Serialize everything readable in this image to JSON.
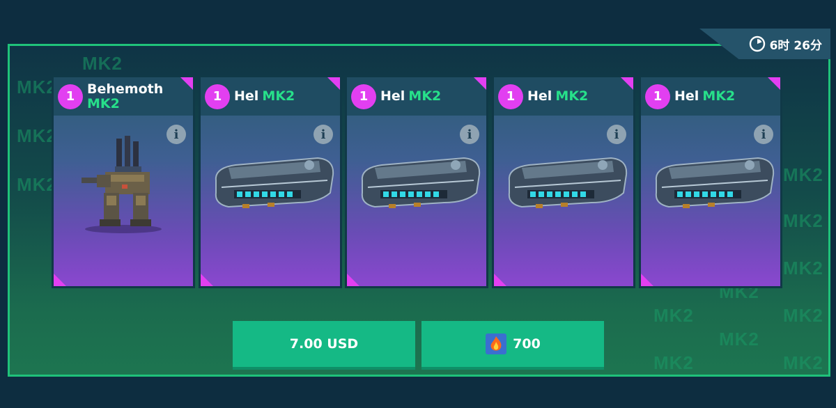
{
  "timer": {
    "icon": "clock-icon",
    "text": "6时 26分"
  },
  "watermarks": [
    "MK2",
    "MK2",
    "MK2",
    "MK2",
    "MK2",
    "MK2",
    "MK2",
    "MK2",
    "MK2",
    "MK2",
    "MK2",
    "MK2",
    "MK2",
    "MK2",
    "MK2",
    "MK2"
  ],
  "cards": [
    {
      "quantity": "1",
      "name": "Behemoth",
      "tier": "MK2",
      "type": "robot",
      "info_icon": "info-icon"
    },
    {
      "quantity": "1",
      "name": "Hel",
      "tier": "MK2",
      "type": "weapon",
      "info_icon": "info-icon"
    },
    {
      "quantity": "1",
      "name": "Hel",
      "tier": "MK2",
      "type": "weapon",
      "info_icon": "info-icon"
    },
    {
      "quantity": "1",
      "name": "Hel",
      "tier": "MK2",
      "type": "weapon",
      "info_icon": "info-icon"
    },
    {
      "quantity": "1",
      "name": "Hel",
      "tier": "MK2",
      "type": "weapon",
      "info_icon": "info-icon"
    }
  ],
  "purchase": {
    "price_usd_label": "7.00 USD",
    "price_currency": "700",
    "currency_icon": "platinum-fire-icon"
  },
  "colors": {
    "accent_green": "#1fc27a",
    "tier_green": "#27e08a",
    "rarity_magenta": "#e23ff1",
    "button_green": "#15b985"
  }
}
